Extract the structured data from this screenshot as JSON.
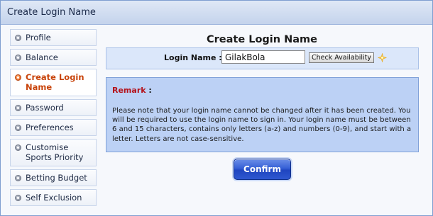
{
  "window": {
    "title": "Create Login Name"
  },
  "sidebar": {
    "items": [
      {
        "label": "Profile",
        "active": false
      },
      {
        "label": "Balance",
        "active": false
      },
      {
        "label": "Create Login Name",
        "active": true
      },
      {
        "label": "Password",
        "active": false
      },
      {
        "label": "Preferences",
        "active": false
      },
      {
        "label": "Customise Sports Priority",
        "active": false
      },
      {
        "label": "Betting Budget",
        "active": false
      },
      {
        "label": "Self Exclusion",
        "active": false
      }
    ]
  },
  "main": {
    "heading": "Create Login Name",
    "form": {
      "login_label": "Login Name :",
      "login_value": "GilakBola",
      "check_button_label": "Check Availability",
      "status_icon": "sparkle-icon"
    },
    "remark": {
      "title": "Remark",
      "title_suffix": " :",
      "text": "Please note that your login name cannot be changed after it has been created. You will be required to use the login name to sign in. Your login name must be between 6 and 15 characters, contains only letters (a-z) and numbers (0-9), and start with a letter. Letters are not case-sensitive."
    },
    "confirm_label": "Confirm"
  },
  "colors": {
    "accent": "#c8430a",
    "remark_title": "#b4121b",
    "confirm_button": "#2e57d0",
    "remark_panel": "#bcd1f5",
    "form_panel": "#dbe7fa"
  }
}
